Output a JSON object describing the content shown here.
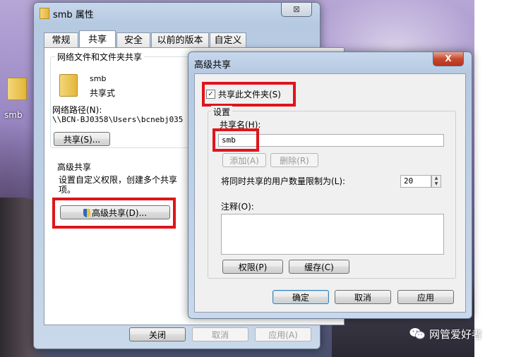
{
  "desktop": {
    "icon_label": "smb"
  },
  "props_window": {
    "title": "smb 属性",
    "close_glyph": "⊠",
    "tabs": [
      "常规",
      "共享",
      "安全",
      "以前的版本",
      "自定义"
    ],
    "share_group_title": "网络文件和文件夹共享",
    "folder_name": "smb",
    "folder_state": "共享式",
    "network_path_label": "网络路径(N):",
    "network_path_value": "\\\\BCN-BJ0358\\Users\\bcnebj035",
    "share_button": "共享(S)...",
    "adv_title": "高级共享",
    "adv_desc_line1": "设置自定义权限，创建多个共享",
    "adv_desc_line2": "项。",
    "adv_button": "高级共享(D)...",
    "footer": {
      "close": "关闭",
      "cancel": "取消",
      "apply": "应用(A)"
    }
  },
  "adv_dialog": {
    "title": "高级共享",
    "close_glyph": "X",
    "share_checkbox_label": "共享此文件夹(S)",
    "share_checked": true,
    "settings_label": "设置",
    "share_name_label": "共享名(H):",
    "share_name_value": "smb",
    "add_button": "添加(A)",
    "remove_button": "删除(R)",
    "limit_label": "将同时共享的用户数量限制为(L):",
    "limit_value": "20",
    "comment_label": "注释(O):",
    "comment_value": "",
    "permissions_button": "权限(P)",
    "cache_button": "缓存(C)",
    "ok": "确定",
    "cancel": "取消",
    "apply": "应用"
  },
  "watermark": {
    "text": "网管爱好者",
    "icon": "wechat-icon"
  }
}
